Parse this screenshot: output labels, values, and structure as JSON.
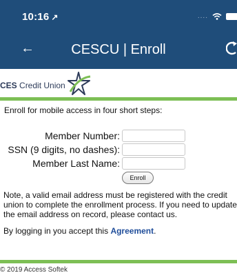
{
  "status_bar": {
    "time": "10:16",
    "location_arrow": "↗",
    "signal": "....",
    "icons": [
      "location-arrow-icon",
      "wifi-icon",
      "battery-icon"
    ]
  },
  "nav": {
    "title": "CESCU | Enroll",
    "back_icon": "back-arrow-icon",
    "back_glyph": "←",
    "refresh_icon": "refresh-icon",
    "color": "#1f4d7a"
  },
  "logo": {
    "prefix": "CES",
    "text": " Credit Union"
  },
  "accent_color": "#7dbf55",
  "intro": "Enroll for mobile access in four short steps:",
  "form": {
    "fields": [
      {
        "label": "Member Number:",
        "value": "",
        "placeholder": ""
      },
      {
        "label": "SSN (9 digits, no dashes):",
        "value": "",
        "placeholder": ""
      },
      {
        "label": "Member Last Name:",
        "value": "",
        "placeholder": ""
      }
    ],
    "submit_label": "Enroll"
  },
  "note": "Note, a valid email address must be registered with the credit union to complete the enrollment process. If you need to update the email address on record, please contact us.",
  "agreement": {
    "prefix": "By logging in you accept this ",
    "link": "Agreement",
    "suffix": "."
  },
  "footer": "© 2019 Access Softek"
}
